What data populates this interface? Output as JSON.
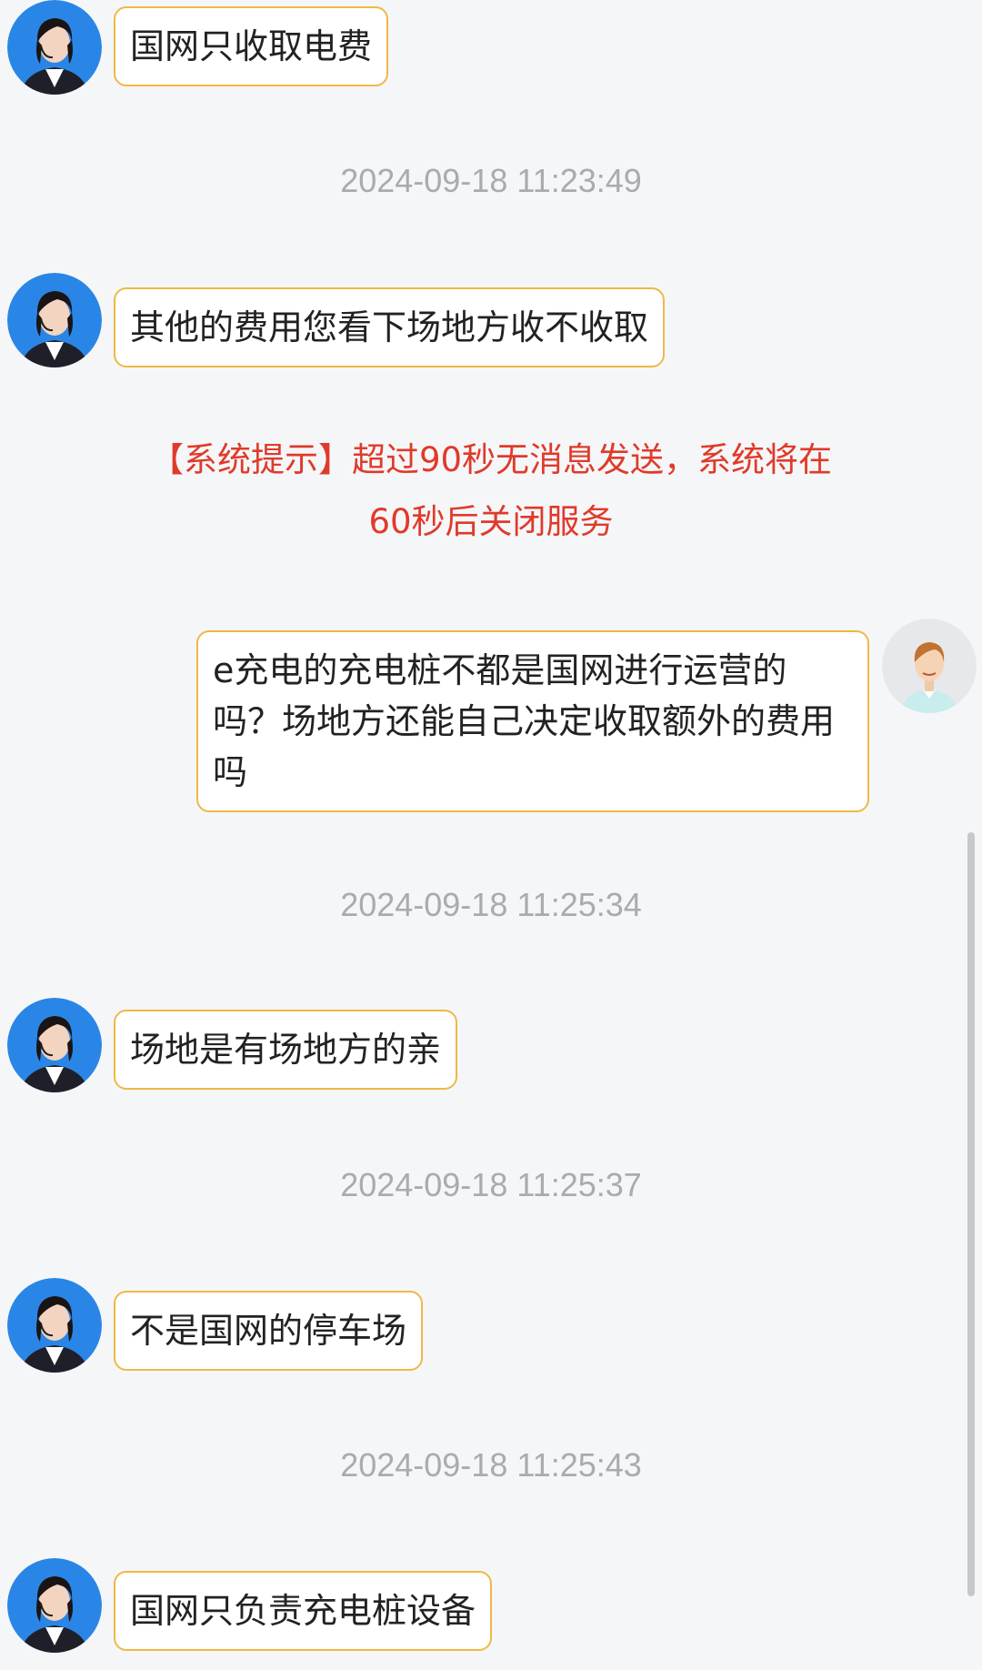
{
  "messages": [
    {
      "type": "agent",
      "text": "国网只收取电费"
    },
    {
      "type": "time",
      "text": "2024-09-18 11:23:49"
    },
    {
      "type": "agent",
      "text": "其他的费用您看下场地方收不收取"
    },
    {
      "type": "system",
      "text": "【系统提示】超过90秒无消息发送，系统将在60秒后关闭服务"
    },
    {
      "type": "user",
      "text": "e充电的充电桩不都是国网进行运营的吗？场地方还能自己决定收取额外的费用吗"
    },
    {
      "type": "time",
      "text": "2024-09-18 11:25:34"
    },
    {
      "type": "agent",
      "text": "场地是有场地方的亲"
    },
    {
      "type": "time",
      "text": "2024-09-18 11:25:37"
    },
    {
      "type": "agent",
      "text": "不是国网的停车场"
    },
    {
      "type": "time",
      "text": "2024-09-18 11:25:43"
    },
    {
      "type": "agent",
      "text": "国网只负责充电桩设备"
    }
  ],
  "avatars": {
    "agent": "customer-service-agent-avatar",
    "user": "user-avatar"
  },
  "colors": {
    "bubble_border": "#f0b846",
    "system_text": "#e03a2a",
    "timestamp_text": "#a9abae",
    "background": "#f5f6f8"
  }
}
